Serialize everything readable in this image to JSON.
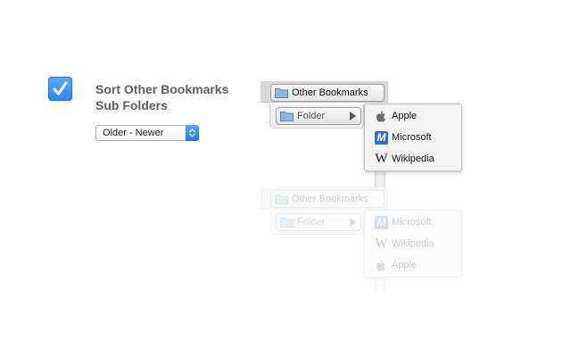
{
  "option": {
    "checked": true,
    "title": "Sort Other Bookmarks Sub Folders",
    "order_select": {
      "selected": "Older - Newer"
    }
  },
  "illustration": {
    "before": {
      "bookmarks_label": "Other Bookmarks",
      "folder_label": "Folder",
      "items": [
        "Apple",
        "Microsoft",
        "Wikipedia"
      ]
    },
    "after": {
      "bookmarks_label": "Other Bookmarks",
      "folder_label": "Folder",
      "items": [
        "Microsoft",
        "Wikipedia",
        "Apple"
      ]
    }
  },
  "colors": {
    "accent": "#2f86f0"
  }
}
